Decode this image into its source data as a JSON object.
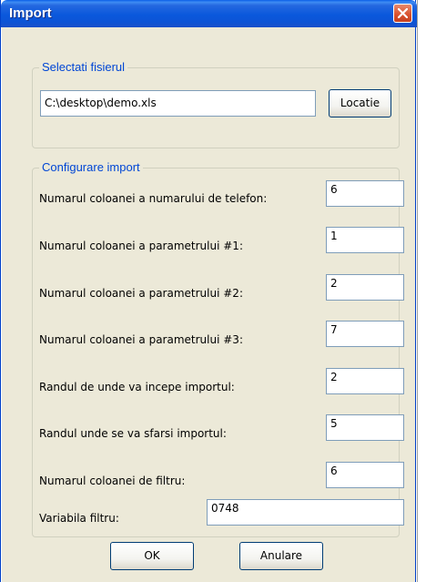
{
  "window": {
    "title": "Import",
    "close_icon": "close-icon"
  },
  "file_group": {
    "legend": "Selectati fisierul",
    "path_value": "C:\\desktop\\demo.xls",
    "browse_label": "Locatie"
  },
  "config_group": {
    "legend": "Configurare import",
    "fields": [
      {
        "label": "Numarul coloanei a numarului de telefon:",
        "value": "6"
      },
      {
        "label": "Numarul coloanei a parametrului #1:",
        "value": "1"
      },
      {
        "label": "Numarul coloanei a parametrului #2:",
        "value": "2"
      },
      {
        "label": "Numarul coloanei a parametrului #3:",
        "value": "7"
      },
      {
        "label": "Randul de unde va incepe importul:",
        "value": "2"
      },
      {
        "label": "Randul unde se va sfarsi importul:",
        "value": "5"
      },
      {
        "label": "Numarul coloanei de filtru:",
        "value": "6"
      }
    ],
    "filter_variable": {
      "label": "Variabila filtru:",
      "value": "0748"
    }
  },
  "buttons": {
    "ok_label": "OK",
    "cancel_label": "Anulare"
  },
  "colors": {
    "title_bar": "#0a58dc",
    "legend_text": "#0046d5",
    "dialog_bg": "#ece9d8",
    "close_button": "#d8502c"
  }
}
